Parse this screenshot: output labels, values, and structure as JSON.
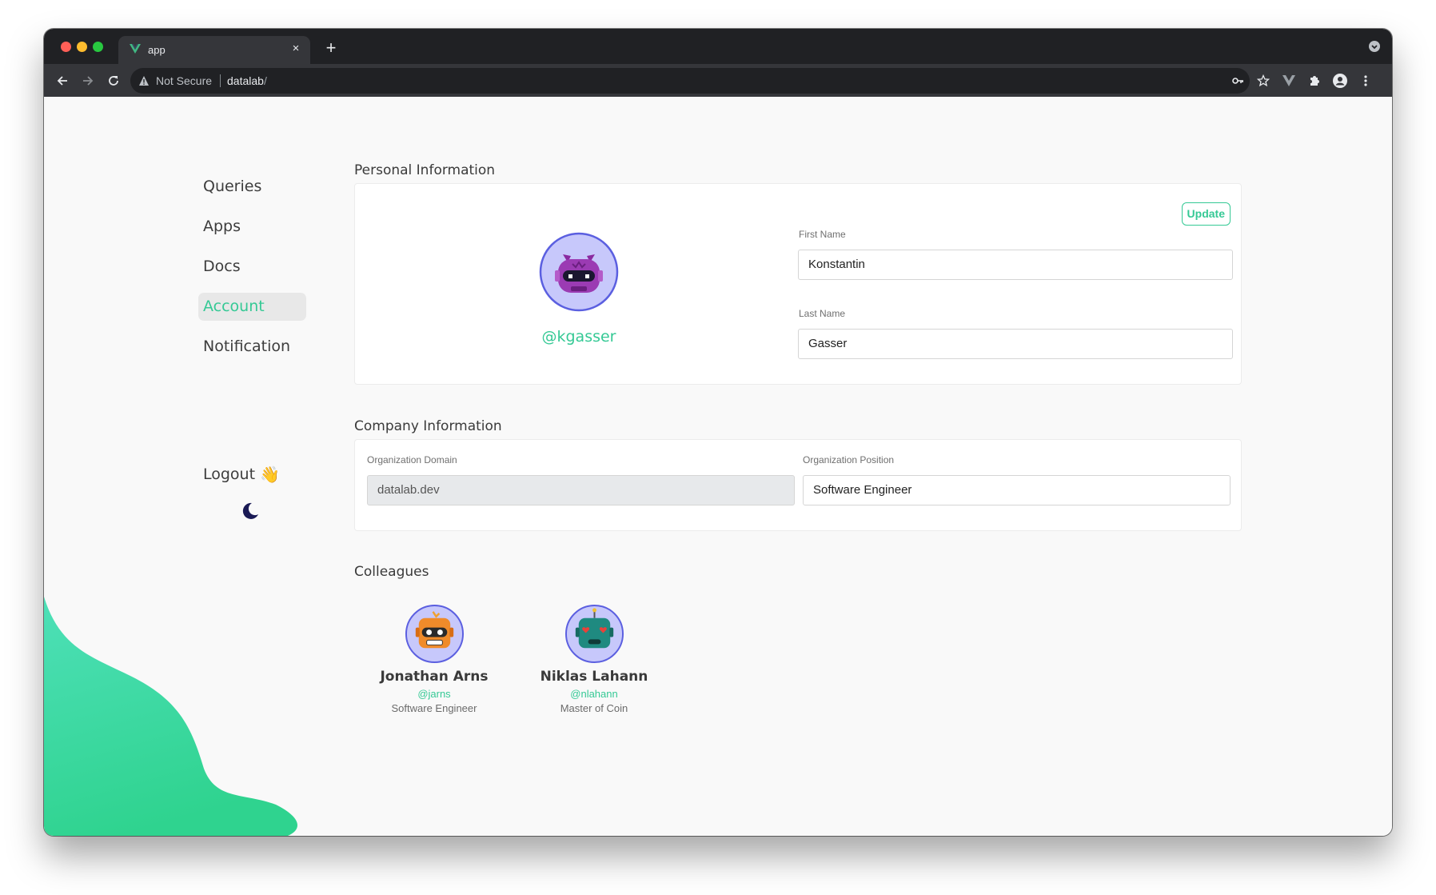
{
  "browser": {
    "tab_title": "app",
    "tab_close": "×",
    "new_tab": "+",
    "security_label": "Not Secure",
    "url_host": "datalab",
    "url_path": "/"
  },
  "sidebar": {
    "items": [
      {
        "label": "Queries"
      },
      {
        "label": "Apps"
      },
      {
        "label": "Docs"
      },
      {
        "label": "Account",
        "active": true
      },
      {
        "label": "Notification"
      }
    ],
    "logout_label": "Logout",
    "logout_emoji": "👋"
  },
  "personal": {
    "section_title": "Personal Information",
    "handle": "@kgasser",
    "update_label": "Update",
    "first_name_label": "First Name",
    "first_name_value": "Konstantin",
    "last_name_label": "Last Name",
    "last_name_value": "Gasser"
  },
  "company": {
    "section_title": "Company Information",
    "domain_label": "Organization Domain",
    "domain_value": "datalab.dev",
    "position_label": "Organization Position",
    "position_value": "Software Engineer"
  },
  "colleagues": {
    "section_title": "Colleagues",
    "items": [
      {
        "name": "Jonathan Arns",
        "handle": "@jarns",
        "role": "Software Engineer"
      },
      {
        "name": "Niklas Lahann",
        "handle": "@nlahann",
        "role": "Master of Coin"
      }
    ]
  },
  "colors": {
    "accent": "#35c995",
    "avatar_ring": "#5b5fe0",
    "avatar_bg": "#c7c8fb"
  }
}
